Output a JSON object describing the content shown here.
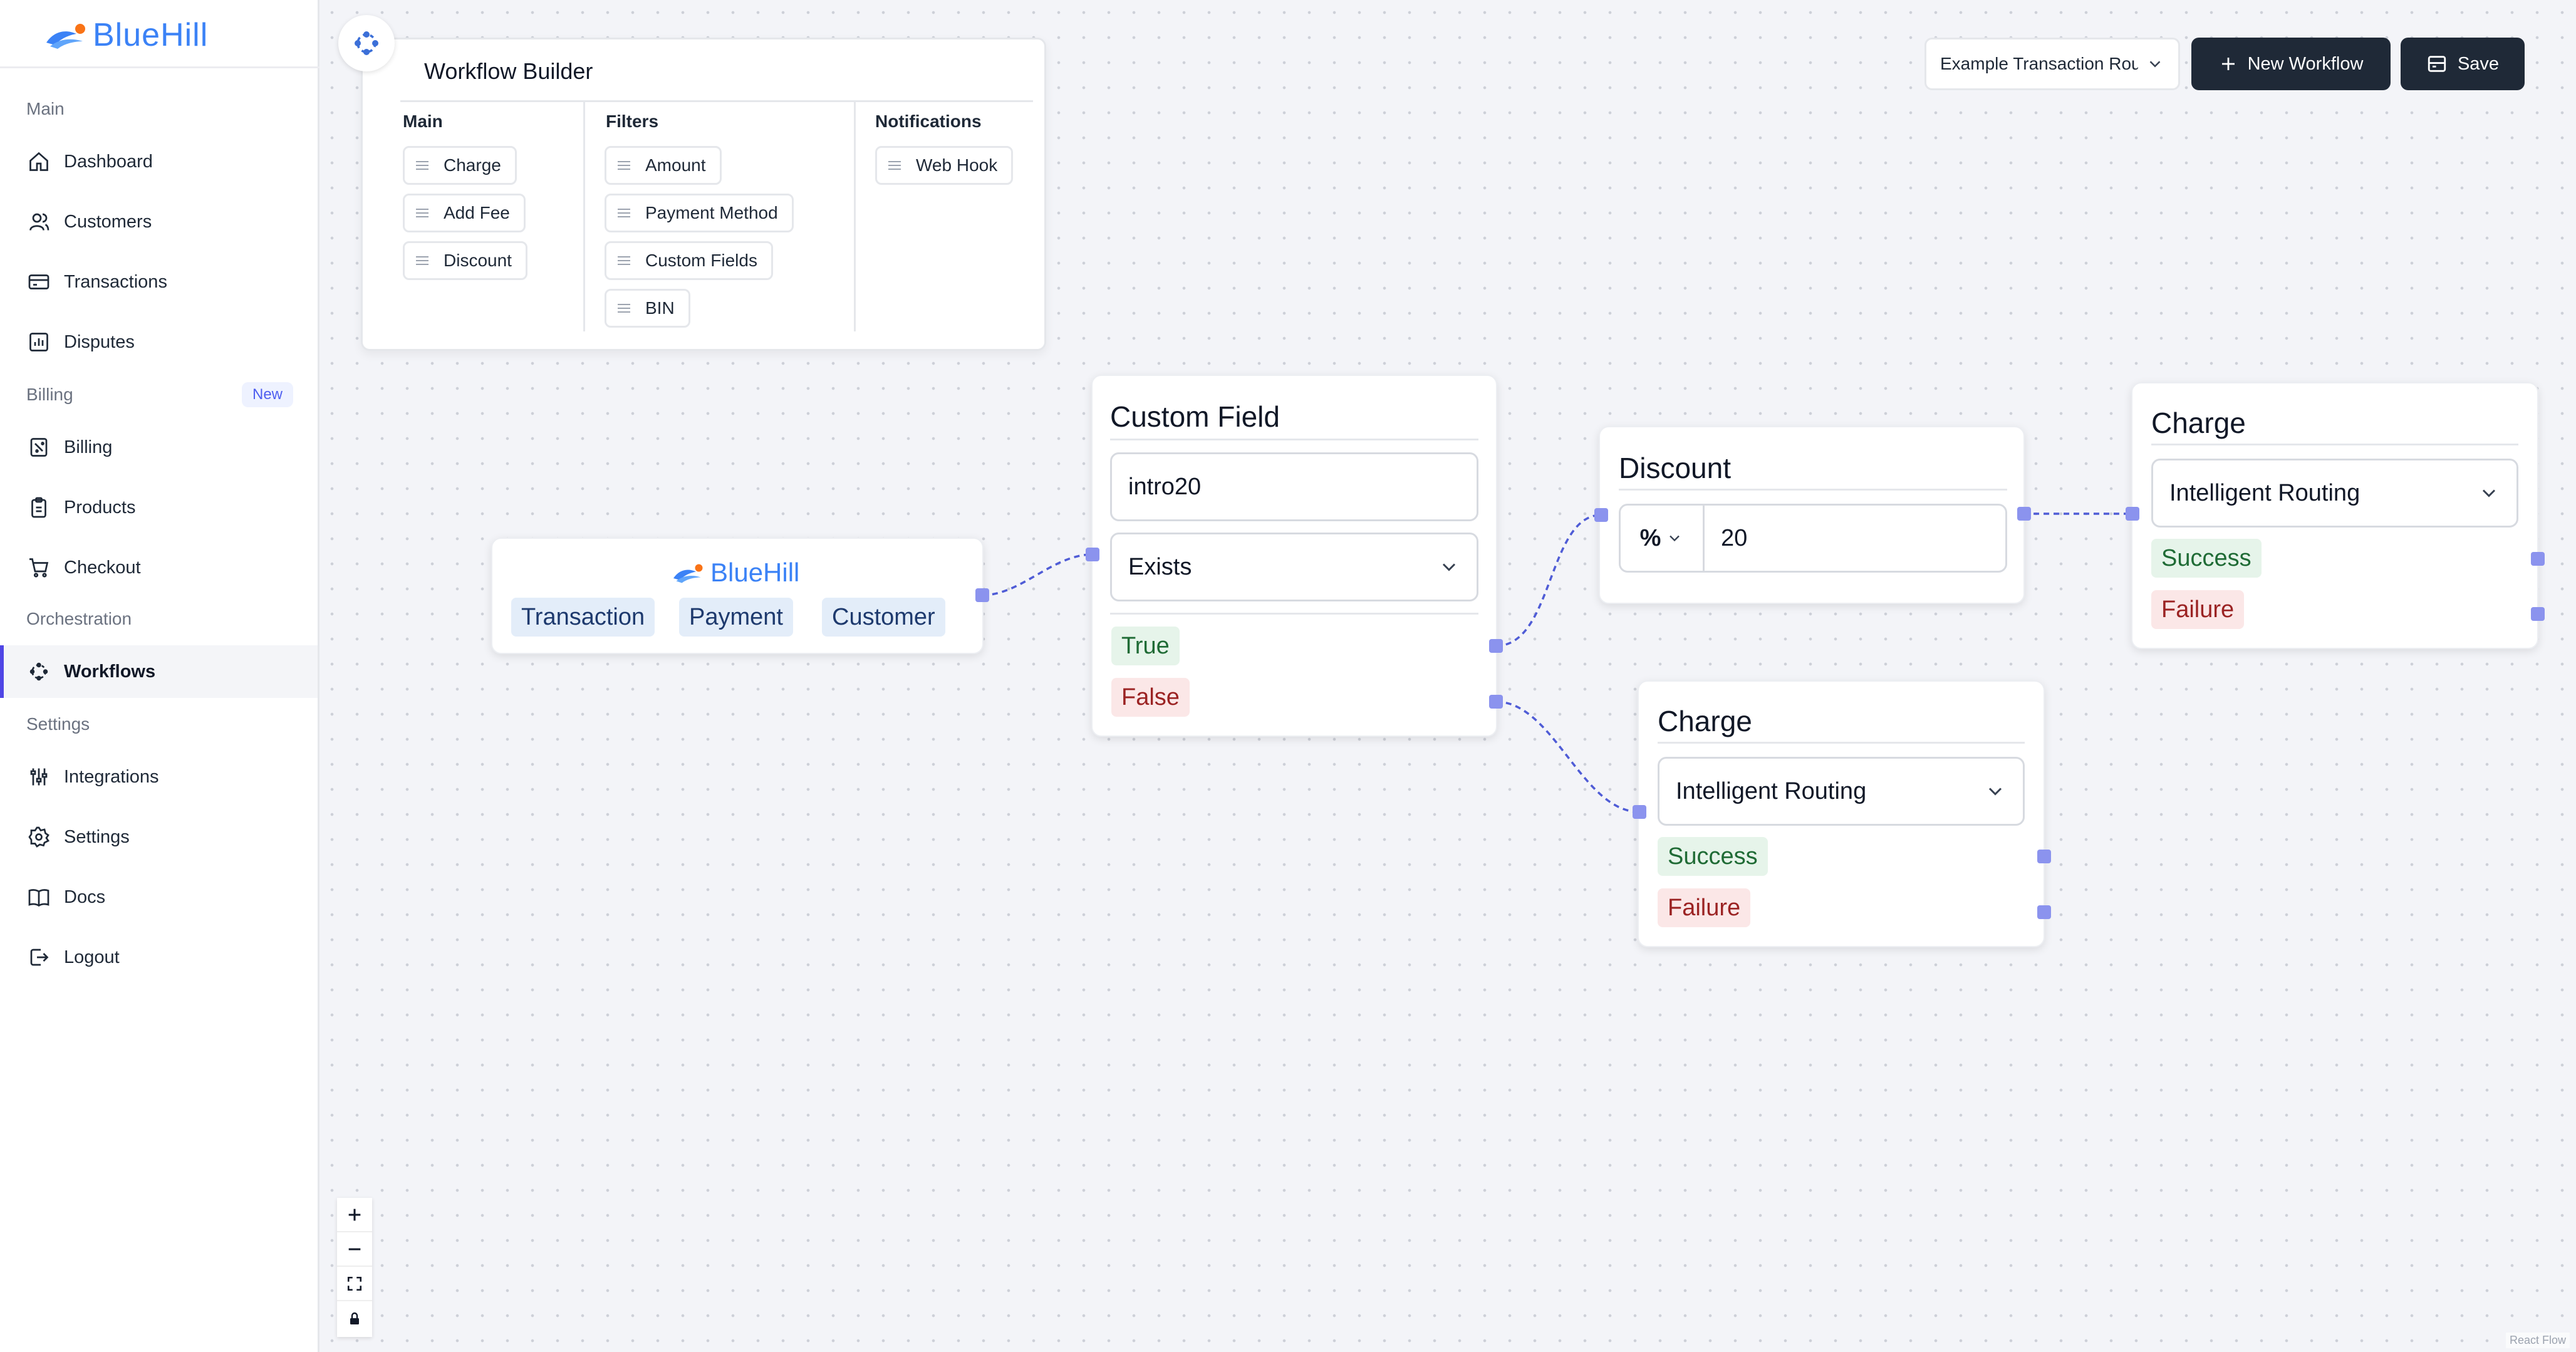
{
  "app": {
    "brand": "BlueHill"
  },
  "sidebar": {
    "sections": {
      "main": "Main",
      "billing": "Billing",
      "billing_badge": "New",
      "orchestration": "Orchestration",
      "settings": "Settings"
    },
    "items": [
      {
        "label": "Dashboard",
        "icon": "home-icon"
      },
      {
        "label": "Customers",
        "icon": "users-icon"
      },
      {
        "label": "Transactions",
        "icon": "credit-card-icon"
      },
      {
        "label": "Disputes",
        "icon": "bar-chart-icon"
      },
      {
        "label": "Billing",
        "icon": "receipt-icon"
      },
      {
        "label": "Products",
        "icon": "clipboard-icon"
      },
      {
        "label": "Checkout",
        "icon": "cart-icon"
      },
      {
        "label": "Workflows",
        "icon": "workflow-icon",
        "active": true
      },
      {
        "label": "Integrations",
        "icon": "sliders-icon"
      },
      {
        "label": "Settings",
        "icon": "gear-icon"
      },
      {
        "label": "Docs",
        "icon": "book-icon"
      },
      {
        "label": "Logout",
        "icon": "logout-icon"
      }
    ]
  },
  "builder": {
    "title": "Workflow Builder",
    "columns": [
      {
        "title": "Main",
        "chips": [
          "Charge",
          "Add Fee",
          "Discount"
        ]
      },
      {
        "title": "Filters",
        "chips": [
          "Amount",
          "Payment Method",
          "Custom Fields",
          "BIN"
        ]
      },
      {
        "title": "Notifications",
        "chips": [
          "Web Hook"
        ]
      }
    ]
  },
  "toolbar": {
    "workflow_select": "Example Transaction Routing",
    "new_workflow": "New Workflow",
    "save": "Save"
  },
  "flow": {
    "source": {
      "brand": "BlueHill",
      "tags": [
        "Transaction",
        "Payment",
        "Customer"
      ]
    },
    "custom_field": {
      "title": "Custom Field",
      "value": "intro20",
      "operator": "Exists",
      "true_label": "True",
      "false_label": "False"
    },
    "discount": {
      "title": "Discount",
      "unit": "%",
      "value": "20"
    },
    "charge_top": {
      "title": "Charge",
      "routing": "Intelligent Routing",
      "success": "Success",
      "failure": "Failure"
    },
    "charge_bottom": {
      "title": "Charge",
      "routing": "Intelligent Routing",
      "success": "Success",
      "failure": "Failure"
    }
  },
  "canvas": {
    "attribution": "React Flow",
    "accent_color": "#8b93ee"
  }
}
